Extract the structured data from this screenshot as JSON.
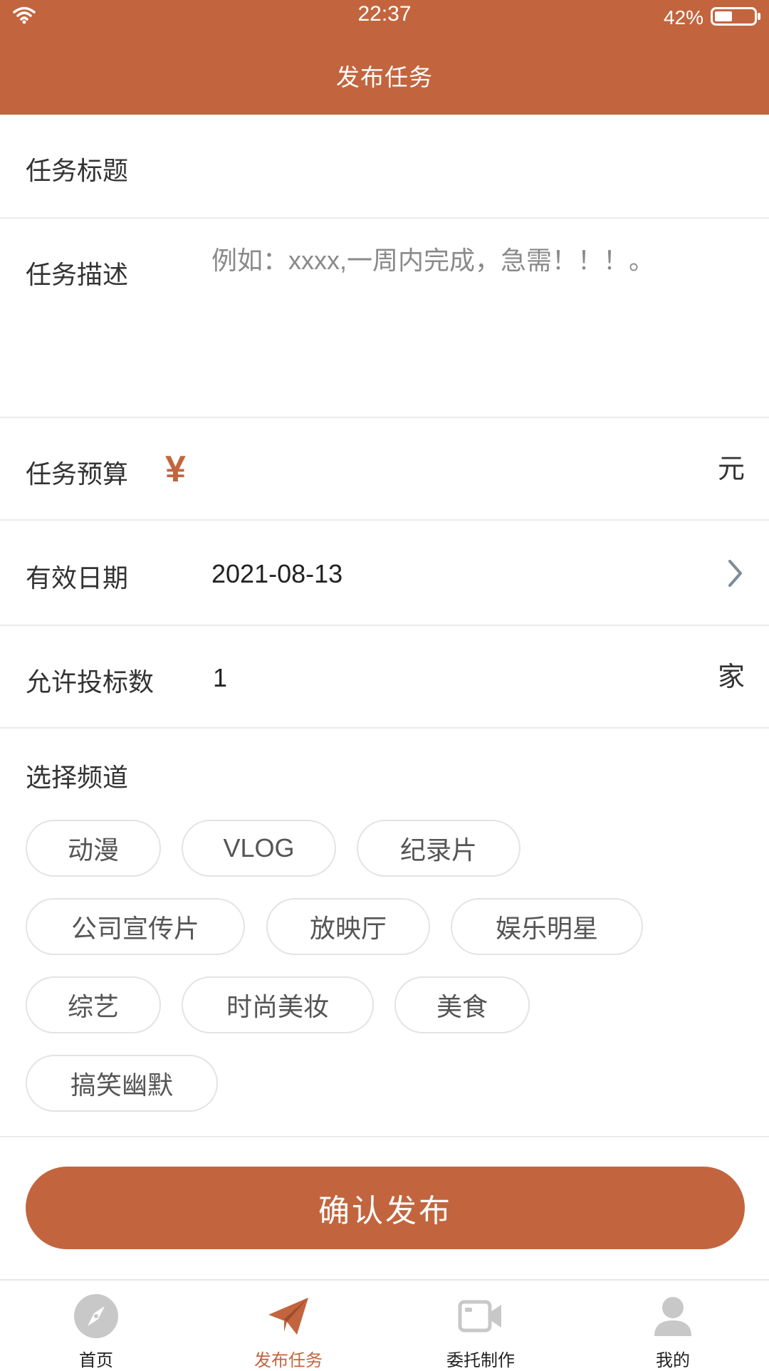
{
  "status_bar": {
    "time": "22:37",
    "battery": "42%"
  },
  "nav": {
    "title": "发布任务"
  },
  "form": {
    "title_label": "任务标题",
    "title_value": "",
    "desc_label": "任务描述",
    "desc_placeholder": "例如：xxxx,一周内完成，急需！！！。",
    "budget_label": "任务预算",
    "budget_currency": "¥",
    "budget_value": "",
    "budget_unit": "元",
    "date_label": "有效日期",
    "date_value": "2021-08-13",
    "bids_label": "允许投标数",
    "bids_value": "1",
    "bids_unit": "家"
  },
  "channels": {
    "title": "选择频道",
    "options": [
      "动漫",
      "VLOG",
      "纪录片",
      "公司宣传片",
      "放映厅",
      "娱乐明星",
      "综艺",
      "时尚美妆",
      "美食",
      "搞笑幽默"
    ]
  },
  "submit": {
    "label": "确认发布"
  },
  "tabs": [
    {
      "label": "首页",
      "icon": "compass-icon"
    },
    {
      "label": "发布任务",
      "icon": "paper-plane-icon",
      "active": true
    },
    {
      "label": "委托制作",
      "icon": "video-camera-icon"
    },
    {
      "label": "我的",
      "icon": "user-icon"
    }
  ],
  "colors": {
    "accent": "#C2653E",
    "inactive_icon": "#C8C8C8"
  }
}
